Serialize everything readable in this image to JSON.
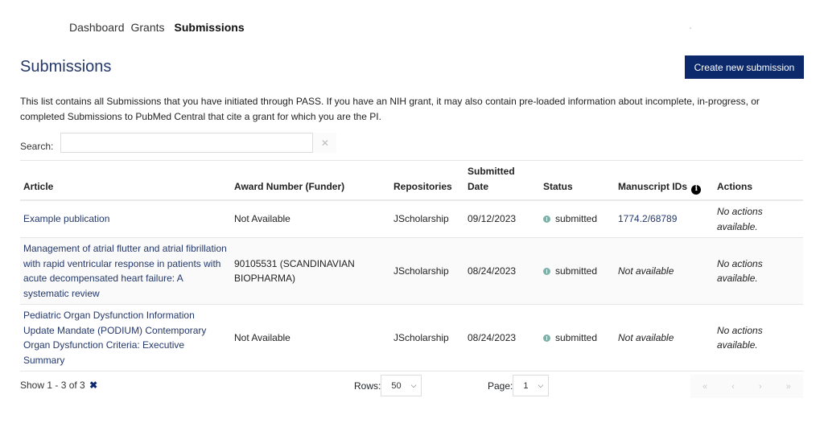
{
  "nav": {
    "items": [
      {
        "label": "Dashboard",
        "active": false
      },
      {
        "label": "Grants",
        "active": false
      },
      {
        "label": "Submissions",
        "active": true
      }
    ]
  },
  "page": {
    "title": "Submissions",
    "create_button": "Create new submission",
    "description": "This list contains all Submissions that you have initiated through PASS. If you have an NIH grant, it may also contain pre-loaded information about incomplete, in-progress, or completed Submissions to PubMed Central that cite a grant for which you are the PI."
  },
  "search": {
    "label": "Search:",
    "value": "",
    "placeholder": "",
    "clear_icon": "✕"
  },
  "table": {
    "headers": {
      "article": "Article",
      "award": "Award Number (Funder)",
      "repositories": "Repositories",
      "submitted_date_line1": "Submitted",
      "submitted_date_line2": "Date",
      "status": "Status",
      "manuscript_ids": "Manuscript IDs",
      "actions": "Actions"
    },
    "info_icon": "i",
    "rows": [
      {
        "article": "Example publication",
        "award": "Not Available",
        "repositories": "JScholarship",
        "submitted_date": "09/12/2023",
        "status": "submitted",
        "manuscript_id": "1774.2/68789",
        "actions": "No actions available."
      },
      {
        "article": "Management of atrial flutter and atrial fibrillation with rapid ventricular response in patients with acute decompensated heart failure: A systematic review",
        "award": "90105531 (SCANDINAVIAN BIOPHARMA)",
        "repositories": "JScholarship",
        "submitted_date": "08/24/2023",
        "status": "submitted",
        "manuscript_id": "Not available",
        "actions": "No actions available."
      },
      {
        "article": "Pediatric Organ Dysfunction Information Update Mandate (PODIUM) Contemporary Organ Dysfunction Criteria: Executive Summary",
        "award": "Not Available",
        "repositories": "JScholarship",
        "submitted_date": "08/24/2023",
        "status": "submitted",
        "manuscript_id": "Not available",
        "actions": "No actions available."
      }
    ]
  },
  "footer": {
    "show_text": "Show 1 - 3 of 3",
    "clear_icon": "✖",
    "rows_label": "Rows:",
    "rows_value": "50",
    "page_label": "Page:",
    "page_value": "1",
    "chevron": "⌄",
    "pager": {
      "first": "«",
      "prev": "‹",
      "next": "›",
      "last": "»"
    }
  },
  "colors": {
    "brand": "#0c2a6b",
    "link": "#24386b",
    "status_info": "#7fb0a8"
  }
}
